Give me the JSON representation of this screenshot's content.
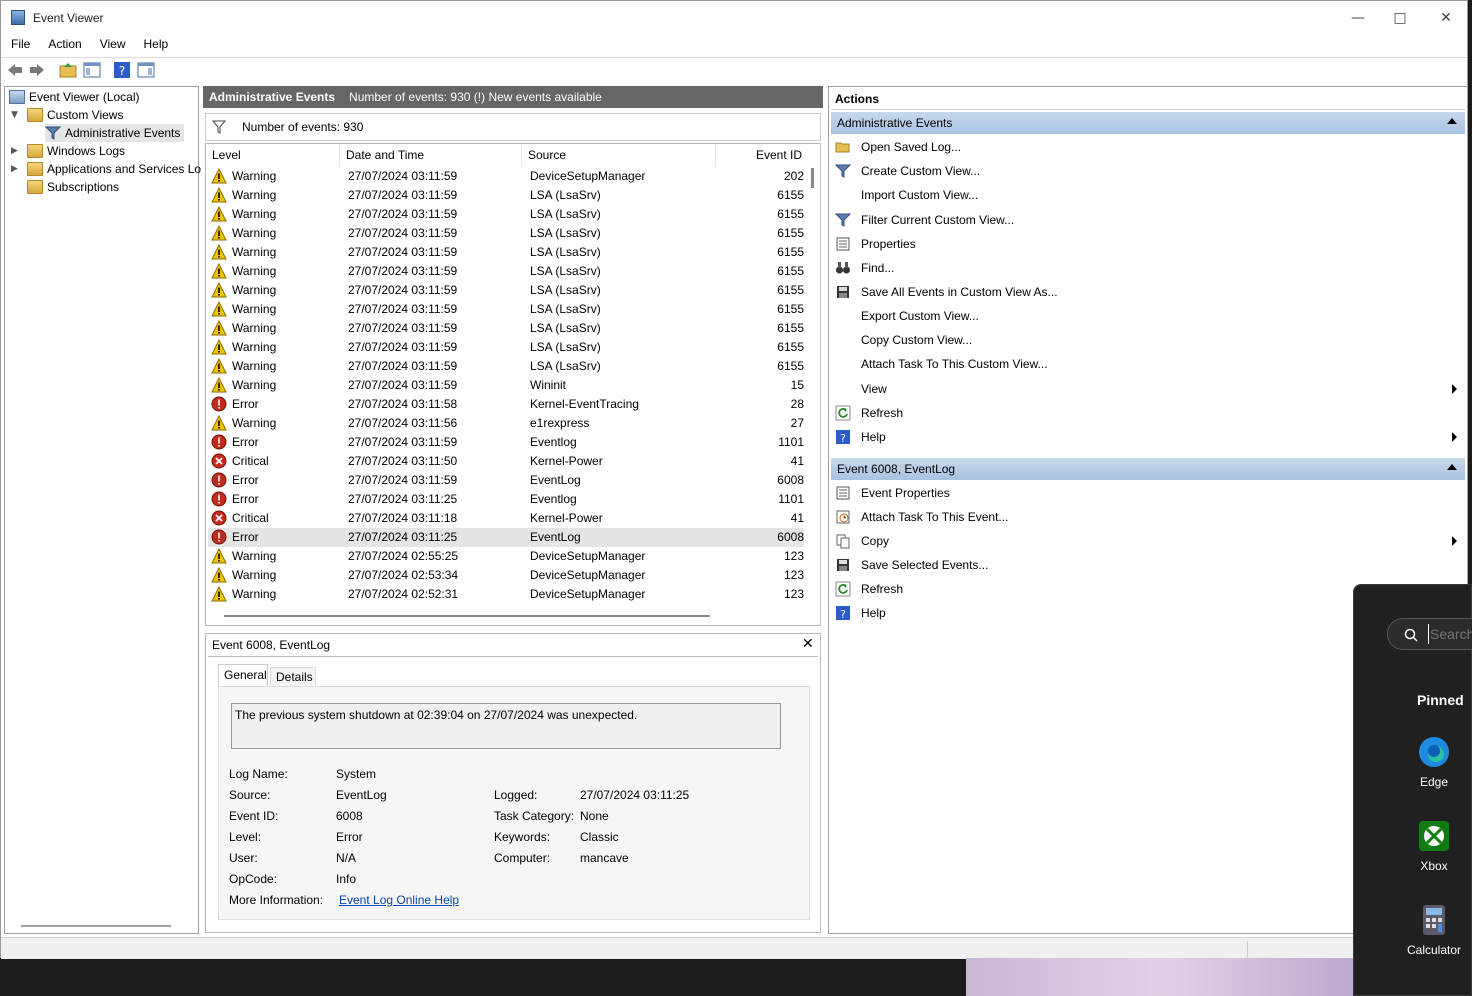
{
  "window": {
    "title": "Event Viewer"
  },
  "menubar": [
    "File",
    "Action",
    "View",
    "Help"
  ],
  "tree": {
    "root": "Event Viewer (Local)",
    "custom_views": "Custom Views",
    "admin_events": "Administrative Events",
    "windows_logs": "Windows Logs",
    "apps_services": "Applications and Services Lo",
    "subscriptions": "Subscriptions"
  },
  "center": {
    "header_title": "Administrative Events",
    "header_info": "Number of events: 930 (!) New events available",
    "filter_text": "Number of events: 930",
    "columns": [
      "Level",
      "Date and Time",
      "Source",
      "Event ID"
    ],
    "rows": [
      {
        "level": "Warning",
        "date": "27/07/2024 03:11:59",
        "source": "DeviceSetupManager",
        "id": "202"
      },
      {
        "level": "Warning",
        "date": "27/07/2024 03:11:59",
        "source": "LSA (LsaSrv)",
        "id": "6155"
      },
      {
        "level": "Warning",
        "date": "27/07/2024 03:11:59",
        "source": "LSA (LsaSrv)",
        "id": "6155"
      },
      {
        "level": "Warning",
        "date": "27/07/2024 03:11:59",
        "source": "LSA (LsaSrv)",
        "id": "6155"
      },
      {
        "level": "Warning",
        "date": "27/07/2024 03:11:59",
        "source": "LSA (LsaSrv)",
        "id": "6155"
      },
      {
        "level": "Warning",
        "date": "27/07/2024 03:11:59",
        "source": "LSA (LsaSrv)",
        "id": "6155"
      },
      {
        "level": "Warning",
        "date": "27/07/2024 03:11:59",
        "source": "LSA (LsaSrv)",
        "id": "6155"
      },
      {
        "level": "Warning",
        "date": "27/07/2024 03:11:59",
        "source": "LSA (LsaSrv)",
        "id": "6155"
      },
      {
        "level": "Warning",
        "date": "27/07/2024 03:11:59",
        "source": "LSA (LsaSrv)",
        "id": "6155"
      },
      {
        "level": "Warning",
        "date": "27/07/2024 03:11:59",
        "source": "LSA (LsaSrv)",
        "id": "6155"
      },
      {
        "level": "Warning",
        "date": "27/07/2024 03:11:59",
        "source": "LSA (LsaSrv)",
        "id": "6155"
      },
      {
        "level": "Warning",
        "date": "27/07/2024 03:11:59",
        "source": "Wininit",
        "id": "15"
      },
      {
        "level": "Error",
        "date": "27/07/2024 03:11:58",
        "source": "Kernel-EventTracing",
        "id": "28"
      },
      {
        "level": "Warning",
        "date": "27/07/2024 03:11:56",
        "source": "e1rexpress",
        "id": "27"
      },
      {
        "level": "Error",
        "date": "27/07/2024 03:11:59",
        "source": "Eventlog",
        "id": "1101"
      },
      {
        "level": "Critical",
        "date": "27/07/2024 03:11:50",
        "source": "Kernel-Power",
        "id": "41"
      },
      {
        "level": "Error",
        "date": "27/07/2024 03:11:59",
        "source": "EventLog",
        "id": "6008"
      },
      {
        "level": "Error",
        "date": "27/07/2024 03:11:25",
        "source": "Eventlog",
        "id": "1101"
      },
      {
        "level": "Critical",
        "date": "27/07/2024 03:11:18",
        "source": "Kernel-Power",
        "id": "41"
      },
      {
        "level": "Error",
        "date": "27/07/2024 03:11:25",
        "source": "EventLog",
        "id": "6008"
      },
      {
        "level": "Warning",
        "date": "27/07/2024 02:55:25",
        "source": "DeviceSetupManager",
        "id": "123"
      },
      {
        "level": "Warning",
        "date": "27/07/2024 02:53:34",
        "source": "DeviceSetupManager",
        "id": "123"
      },
      {
        "level": "Warning",
        "date": "27/07/2024 02:52:31",
        "source": "DeviceSetupManager",
        "id": "123"
      }
    ],
    "selected_row": 19
  },
  "detail": {
    "title": "Event 6008, EventLog",
    "tabs": [
      "General",
      "Details"
    ],
    "message": "The previous system shutdown at 02:39:04 on 27/07/2024 was unexpected.",
    "log_name_label": "Log Name:",
    "log_name": "System",
    "source_label": "Source:",
    "source": "EventLog",
    "logged_label": "Logged:",
    "logged": "27/07/2024 03:11:25",
    "event_id_label": "Event ID:",
    "event_id": "6008",
    "task_label": "Task Category:",
    "task": "None",
    "level_label": "Level:",
    "level": "Error",
    "keywords_label": "Keywords:",
    "keywords": "Classic",
    "user_label": "User:",
    "user": "N/A",
    "computer_label": "Computer:",
    "computer": "mancave",
    "opcode_label": "OpCode:",
    "opcode": "Info",
    "more_info_label": "More Information:",
    "more_info_link": "Event Log Online Help"
  },
  "actions": {
    "title": "Actions",
    "section1": "Administrative Events",
    "items1": [
      {
        "label": "Open Saved Log...",
        "icon": "folder-open-icon"
      },
      {
        "label": "Create Custom View...",
        "icon": "funnel-icon"
      },
      {
        "label": "Import Custom View...",
        "icon": ""
      },
      {
        "label": "Filter Current Custom View...",
        "icon": "funnel-icon"
      },
      {
        "label": "Properties",
        "icon": "properties-icon"
      },
      {
        "label": "Find...",
        "icon": "binoculars-icon"
      },
      {
        "label": "Save All Events in Custom View As...",
        "icon": "save-icon"
      },
      {
        "label": "Export Custom View...",
        "icon": ""
      },
      {
        "label": "Copy Custom View...",
        "icon": ""
      },
      {
        "label": "Attach Task To This Custom View...",
        "icon": ""
      },
      {
        "label": "View",
        "icon": "",
        "submenu": true
      },
      {
        "label": "Refresh",
        "icon": "refresh-icon"
      },
      {
        "label": "Help",
        "icon": "help-icon",
        "submenu": true
      }
    ],
    "section2": "Event 6008, EventLog",
    "items2": [
      {
        "label": "Event Properties",
        "icon": "properties-icon"
      },
      {
        "label": "Attach Task To This Event...",
        "icon": "task-icon"
      },
      {
        "label": "Copy",
        "icon": "copy-icon",
        "submenu": true
      },
      {
        "label": "Save Selected Events...",
        "icon": "save-icon"
      },
      {
        "label": "Refresh",
        "icon": "refresh-icon"
      },
      {
        "label": "Help",
        "icon": "help-icon"
      }
    ]
  },
  "startmenu": {
    "search_placeholder": "Search",
    "pinned_label": "Pinned",
    "apps": [
      "Edge",
      "Xbox",
      "Calculator"
    ]
  }
}
